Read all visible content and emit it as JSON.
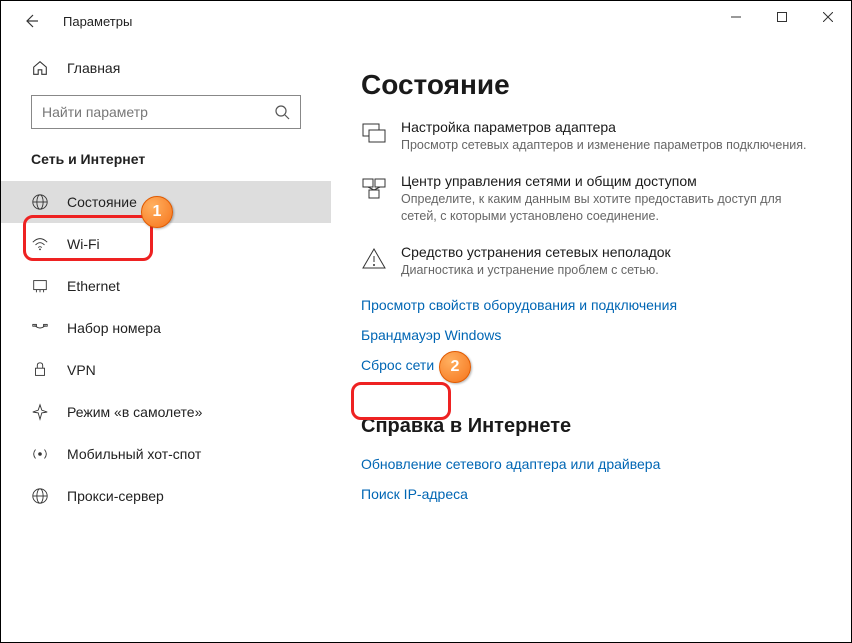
{
  "window": {
    "title": "Параметры"
  },
  "sidebar": {
    "home": "Главная",
    "search_placeholder": "Найти параметр",
    "category": "Сеть и Интернет",
    "items": [
      {
        "label": "Состояние"
      },
      {
        "label": "Wi-Fi"
      },
      {
        "label": "Ethernet"
      },
      {
        "label": "Набор номера"
      },
      {
        "label": "VPN"
      },
      {
        "label": "Режим «в самолете»"
      },
      {
        "label": "Мобильный хот-спот"
      },
      {
        "label": "Прокси-сервер"
      }
    ]
  },
  "page": {
    "title": "Состояние",
    "options": [
      {
        "title": "Настройка параметров адаптера",
        "desc": "Просмотр сетевых адаптеров и изменение параметров подключения."
      },
      {
        "title": "Центр управления сетями и общим доступом",
        "desc": "Определите, к каким данным вы хотите предоставить доступ для сетей, с которыми установлено соединение."
      },
      {
        "title": "Средство устранения сетевых неполадок",
        "desc": "Диагностика и устранение проблем с сетью."
      }
    ],
    "links": [
      "Просмотр свойств оборудования и подключения",
      "Брандмауэр Windows",
      "Сброс сети"
    ],
    "help_title": "Справка в Интернете",
    "help_links": [
      "Обновление сетевого адаптера или драйвера",
      "Поиск IP-адреса"
    ]
  },
  "annotations": {
    "badge1": "1",
    "badge2": "2"
  }
}
